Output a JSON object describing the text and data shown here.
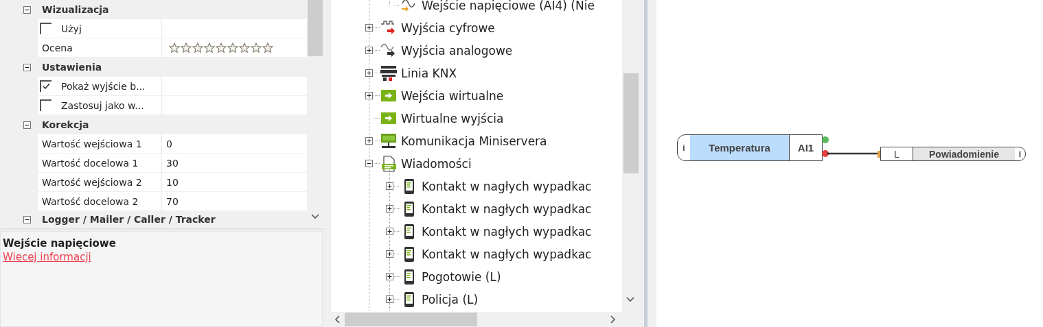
{
  "properties": {
    "categories": [
      {
        "title": "Wizualizacja",
        "expanded": true,
        "rows": [
          {
            "kind": "checkbox",
            "label": "Użyj",
            "checked": false
          },
          {
            "kind": "stars",
            "label": "Ocena",
            "stars": 0
          }
        ]
      },
      {
        "title": "Ustawienia",
        "expanded": true,
        "rows": [
          {
            "kind": "checkbox",
            "label": "Pokaż wyjście b...",
            "checked": true
          },
          {
            "kind": "checkbox",
            "label": "Zastosuj jako w...",
            "checked": false
          }
        ]
      },
      {
        "title": "Korekcja",
        "expanded": true,
        "rows": [
          {
            "kind": "value",
            "label": "Wartość wejściowa 1",
            "value": "0"
          },
          {
            "kind": "value",
            "label": "Wartość docelowa 1",
            "value": "30"
          },
          {
            "kind": "value",
            "label": "Wartość wejściowa 2",
            "value": "10"
          },
          {
            "kind": "value",
            "label": "Wartość docelowa 2",
            "value": "70"
          }
        ]
      },
      {
        "title": "Logger / Mailer / Caller / Tracker",
        "expanded": true
      }
    ]
  },
  "info": {
    "title": "Wejście napięciowe",
    "link": "Wiecej informacji"
  },
  "tree": {
    "scrolled_child": {
      "label": "Wejście napięciowe (AI4) (Nie",
      "kind": "analog-in"
    },
    "items": [
      {
        "label": "Wyjścia cyfrowe",
        "kind": "digital-out",
        "expanded": false
      },
      {
        "label": "Wyjścia analogowe",
        "kind": "analog-out",
        "expanded": false
      },
      {
        "label": "Linia KNX",
        "kind": "knx",
        "expanded": false
      },
      {
        "label": "Wejścia wirtualne",
        "kind": "virtual-in",
        "expanded": false
      },
      {
        "label": "Wirtualne wyjścia",
        "kind": "virtual-out"
      },
      {
        "label": "Komunikacja Miniservera",
        "kind": "network",
        "expanded": false
      },
      {
        "label": "Wiadomości",
        "kind": "log",
        "expanded": true,
        "children": [
          {
            "label": "Kontakt w nagłych wypadkac",
            "kind": "phone",
            "expanded": false
          },
          {
            "label": "Kontakt w nagłych wypadkac",
            "kind": "phone",
            "expanded": false
          },
          {
            "label": "Kontakt w nagłych wypadkac",
            "kind": "phone",
            "expanded": false
          },
          {
            "label": "Kontakt w nagłych wypadkac",
            "kind": "phone",
            "expanded": false
          },
          {
            "label": "Pogotowie (L)",
            "kind": "phone",
            "expanded": false
          },
          {
            "label": "Policja (L)",
            "kind": "phone",
            "expanded": false
          }
        ]
      }
    ]
  },
  "canvas": {
    "blocks": [
      {
        "kind": "input",
        "info": "i",
        "name": "Temperatura",
        "port": "AI1"
      },
      {
        "kind": "output",
        "port": "L",
        "name": "Powiadomienie",
        "info": "i"
      }
    ]
  }
}
